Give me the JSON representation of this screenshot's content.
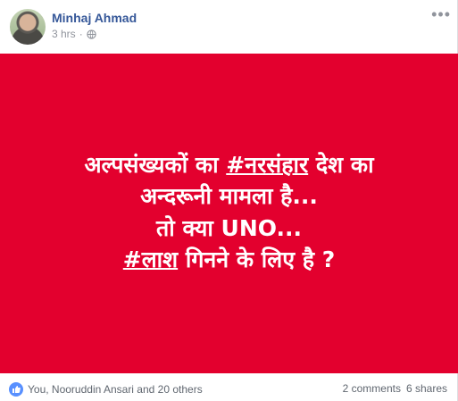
{
  "post": {
    "author_name": "Minhaj Ahmad",
    "time": "3 hrs",
    "separator": "·",
    "more_label": "•••",
    "banner": {
      "background": "#e3002e",
      "line1_before": "अल्पसंख्यकों का ",
      "line1_tag": "#नरसंहार",
      "line1_after": " देश का",
      "line2": "अन्दरूनी मामला है...",
      "line3": "तो क्या UNO...",
      "line4_tag": "#लाश",
      "line4_after": " गिनने के लिए है ?"
    },
    "reactions_text": "You, Nooruddin Ansari and 20 others",
    "comments": "2 comments",
    "shares": "6 shares"
  }
}
